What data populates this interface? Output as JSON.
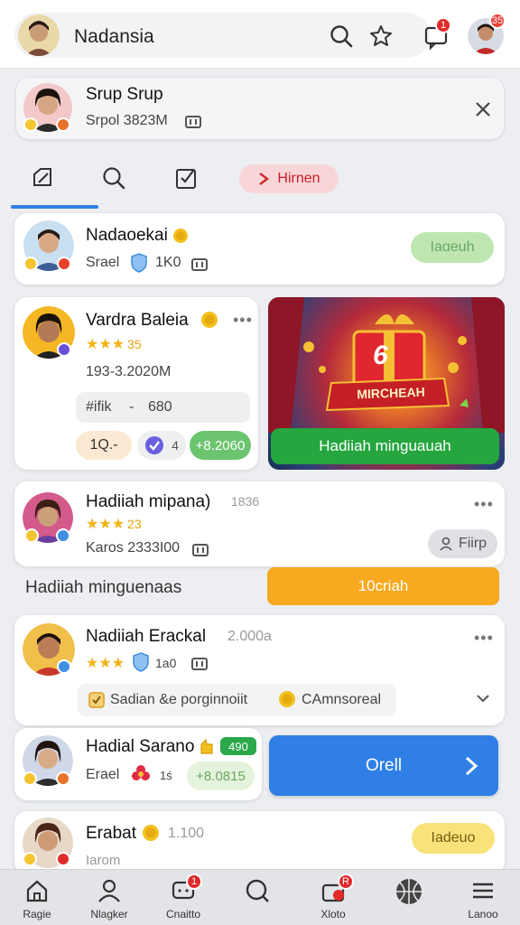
{
  "header": {
    "app_name": "Nadansia",
    "notif_count": "1",
    "profile_count": "35"
  },
  "group_banner": {
    "title": "Srup Srup",
    "subtitle": "Srpol 3823M"
  },
  "tabs": {
    "active_pill_label": "Hirnen"
  },
  "cards": {
    "c1": {
      "name": "Nadaoekai",
      "sub_a": "Srael",
      "sub_b": "1K0",
      "action": "Iaɑeuh"
    },
    "c2": {
      "name": "Vardra Baleia",
      "rating": "35",
      "id": "193-3.2020M",
      "field_label": "#ifik",
      "field_sep": "-",
      "field_value": "680",
      "chip_a": "1Q.-",
      "chip_b": "4",
      "chip_c": "+8.2060"
    },
    "promo": {
      "banner_text": "MIRCHEAH",
      "number": "6",
      "button": "Hadiiah minguauah"
    },
    "c3": {
      "name": "Hadiiah mipana)",
      "suffix": "1836",
      "rating": "23",
      "sub": "Karos 2333I00",
      "action": "Fiirp"
    },
    "section": {
      "label": "Hadiiah minguenaas",
      "button": "10criah"
    },
    "c4": {
      "name": "Nadiiah Erackal",
      "suffix": "2.000a",
      "rating": "1a0",
      "chip_a": "Sadian &e porginnoiit",
      "chip_b": "CAmnsoreal"
    },
    "c5": {
      "name": "Hadial Sarano",
      "tag": "490",
      "sub_a": "Erael",
      "sub_b": "1ś",
      "chip": "+8.0815"
    },
    "open_button": "Orell",
    "c6": {
      "name": "Erabat",
      "sub": "1.100",
      "partial": "Iarom",
      "action": "Iadeuo"
    }
  },
  "bottom_nav": [
    {
      "label": "Ragie",
      "icon": "home-icon"
    },
    {
      "label": "Nlagker",
      "icon": "people-icon"
    },
    {
      "label": "Cnaitto",
      "icon": "chat-icon",
      "badge": "1"
    },
    {
      "label": "",
      "icon": "search-icon"
    },
    {
      "label": "Xloto",
      "icon": "gift-icon",
      "badge": "R"
    },
    {
      "label": "",
      "icon": "basketball-icon"
    },
    {
      "label": "Lanoo",
      "icon": "menu-icon"
    }
  ],
  "colors": {
    "green": "#2fb34a",
    "blue": "#2f7fe6",
    "orange": "#f7a91f",
    "red": "#e02a2a",
    "gold": "#f3b316"
  }
}
